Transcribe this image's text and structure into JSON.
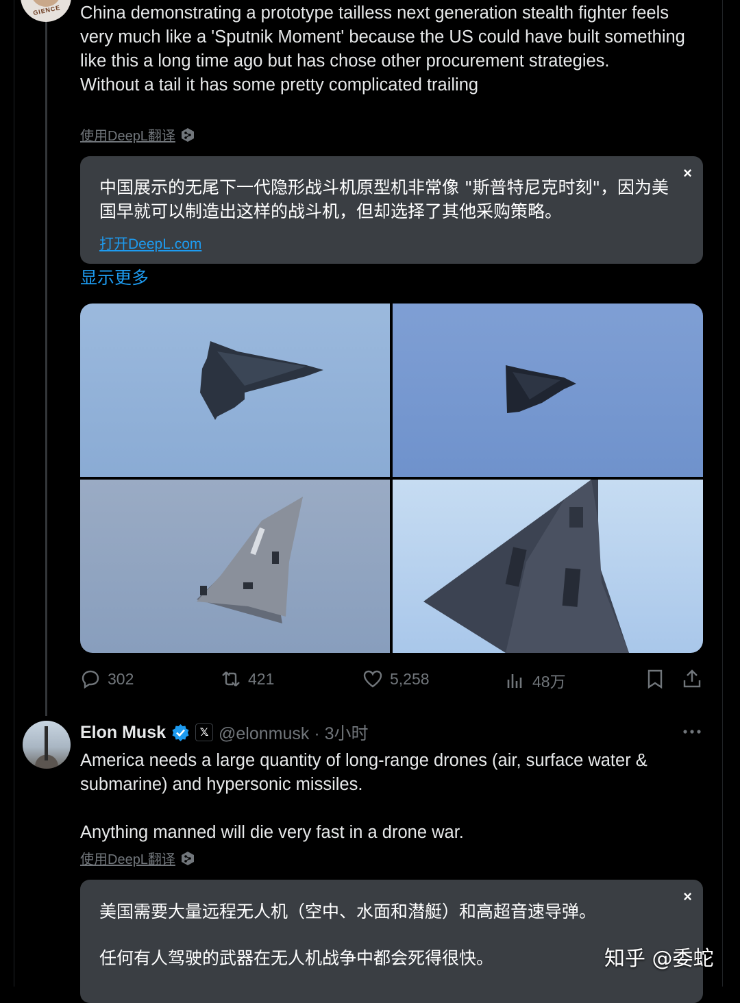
{
  "tweet1": {
    "text": "China demonstrating a prototype tailless next generation stealth fighter feels very much like a 'Sputnik Moment' because the US could have built something like this a long time ago but has chose other procurement strategies.\nWithout a tail it has some pretty complicated trailing",
    "translate_label": "使用DeepL翻译",
    "translation": "中国展示的无尾下一代隐形战斗机原型机非常像 \"斯普特尼克时刻\"，因为美国早就可以制造出这样的战斗机，但却选择了其他采购策略。",
    "open_deepl": "打开DeepL.com",
    "close": "×",
    "show_more": "显示更多",
    "stats": {
      "replies": "302",
      "reposts": "421",
      "likes": "5,258",
      "views": "48万"
    }
  },
  "tweet2": {
    "name": "Elon Musk",
    "x_badge": "𝕏",
    "handle_time": "@elonmusk · 3小时",
    "text": "America needs a large quantity of long-range drones (air, surface water & submarine) and hypersonic missiles.\n\nAnything manned will die very fast in a drone war.",
    "translate_label": "使用DeepL翻译",
    "translation": "美国需要大量远程无人机（空中、水面和潜艇）和高超音速导弹。\n\n任何有人驾驶的武器在无人机战争中都会死得很快。",
    "close": "×"
  },
  "watermark": "知乎 @委蛇",
  "colors": {
    "background": "#000000",
    "text": "#e7e9ea",
    "muted": "#71767b",
    "link": "#1d9bf0",
    "translation_box": "#3a3e43",
    "verified": "#1d9bf0"
  }
}
